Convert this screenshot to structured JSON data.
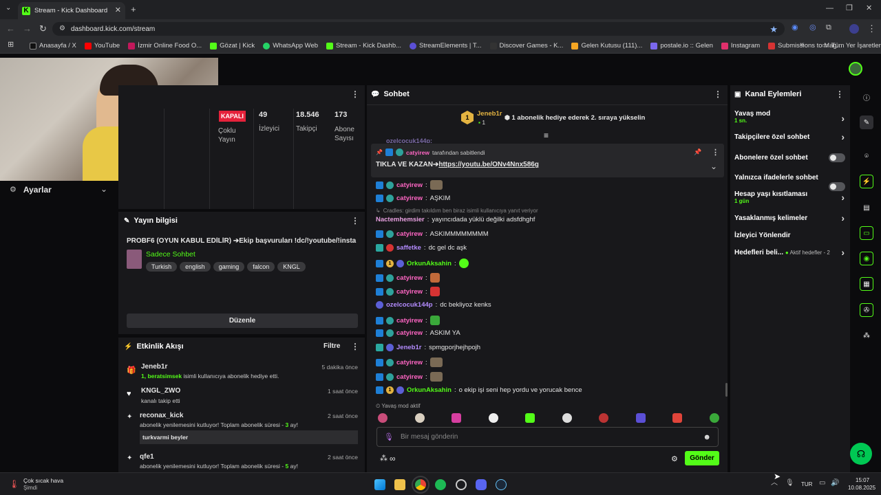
{
  "browser": {
    "tab_title": "Stream - Kick Dashboard",
    "url": "dashboard.kick.com/stream",
    "bookmarks": [
      "Anasayfa / X",
      "YouTube",
      "İzmir Online Food O...",
      "Gözat | Kick",
      "WhatsApp Web",
      "Stream - Kick Dashb...",
      "StreamElements | T...",
      "Discover Games - K...",
      "Gelen Kutusu (111)...",
      "postale.io :: Gelen",
      "Instagram",
      "Submissions to Mag..."
    ],
    "all_bookmarks": "Tüm Yer İşaretleri"
  },
  "sidebar": {
    "settings_label": "Ayarlar"
  },
  "stats": {
    "status": "KAPALI",
    "multi_stream": "Çoklu Yayın",
    "viewers_value": "49",
    "viewers_label": "İzleyici",
    "followers_value": "18.546",
    "followers_label": "Takipçi",
    "subs_value": "173",
    "subs_label": "Abone Sayısı"
  },
  "stream_info": {
    "header": "Yayın bilgisi",
    "title": "PROBF6 (OYUN KABUL EDİLİR) ➔Ekip başvuruları !dc/!youtube/!insta",
    "category": "Sadece Sohbet",
    "tags": [
      "Turkish",
      "english",
      "gaming",
      "falcon",
      "KNGL"
    ],
    "edit_button": "Düzenle"
  },
  "activity": {
    "header": "Etkinlik Akışı",
    "filter": "Filtre",
    "items": [
      {
        "name": "Jeneb1r",
        "time": "5 dakika önce",
        "line1": "1, beratsimsek",
        "line2": " isimli kullanıcıya abonelik hediye etti."
      },
      {
        "name": "KNGL_ZWO",
        "time": "1 saat önce",
        "line1": "kanalı takip etti",
        "line2": ""
      },
      {
        "name": "reconax_kick",
        "time": "2 saat önce",
        "line1": "abonelik yenilemesini kutluyor! Toplam abonelik süresi - ",
        "months": "3",
        "suffix": " ay!",
        "message": "turkvarmi beyler"
      },
      {
        "name": "qfe1",
        "time": "2 saat önce",
        "line1": "abonelik yenilemesini kutluyor! Toplam abonelik süresi - ",
        "months": "5",
        "suffix": " ay!"
      }
    ]
  },
  "chat": {
    "header": "Sohbet",
    "gift_user": "Jeneb1r",
    "gift_count": "1",
    "gift_rank": "1",
    "gift_text": "1 abonelik hediye ederek 2. sıraya yükselin",
    "top_cut_user": "ozelcocuk144p:",
    "pinned_by": "catyirew",
    "pinned_label": "tarafından sabitlendi",
    "pinned_text": "TIKLA VE KAZAN➔",
    "pinned_link": "https://youtu.be/ONv4Nnx586g",
    "reply_text": "Cradles: girdim takıldım ben biraz isimli kullanıcıya yanıt veriyor",
    "messages": [
      {
        "user": "catyirew",
        "text": ""
      },
      {
        "user": "catyirew",
        "text": "AŞKIM"
      },
      {
        "user": "Nactemhemsier",
        "text": "yayıncıdada yüklü değilki adsfdhghf"
      },
      {
        "user": "catyirew",
        "text": "ASKIMMMMMMMM"
      },
      {
        "user": "saffetke",
        "text": "dc gel dc aşk"
      },
      {
        "user": "OrkunAksahin",
        "text": ""
      },
      {
        "user": "catyirew",
        "text": ""
      },
      {
        "user": "catyirew",
        "text": ""
      },
      {
        "user": "ozelcocuk144p",
        "text": "dc bekliyoz kenks"
      },
      {
        "user": "catyirew",
        "text": ""
      },
      {
        "user": "catyirew",
        "text": "ASKIM YA"
      },
      {
        "user": "Jeneb1r",
        "text": "spmgporjhejhpojh"
      },
      {
        "user": "catyirew",
        "text": ""
      },
      {
        "user": "catyirew",
        "text": ""
      },
      {
        "user": "OrkunAksahin",
        "text": "o ekip işi seni hep yordu ve yorucak bence"
      }
    ],
    "slow_mode": "Yavaş mod aktif",
    "input_placeholder": "Bir mesaj gönderin",
    "send_button": "Gönder"
  },
  "channel_actions": {
    "header": "Kanal Eylemleri",
    "slow_mode": "Yavaş mod",
    "slow_mode_value": "1 sn.",
    "followers_only": "Takipçilere özel sohbet",
    "subs_only": "Abonelere özel sohbet",
    "emotes_only": "Yalnızca ifadelerle sohbet",
    "account_age": "Hesap yaşı kısıtlaması",
    "account_age_value": "1 gün",
    "banned_words": "Yasaklanmış kelimeler",
    "redirect": "İzleyici Yönlendir",
    "goals": "Hedefleri beli...",
    "goals_status": "Aktif hedefler - 2"
  },
  "taskbar": {
    "weather_title": "Çok sıcak hava",
    "weather_sub": "Şimdi",
    "lang": "TUR",
    "time": "15:07",
    "date": "10.08.2025"
  },
  "colors": {
    "kick_green": "#53fc18",
    "panel": "#18181b"
  }
}
